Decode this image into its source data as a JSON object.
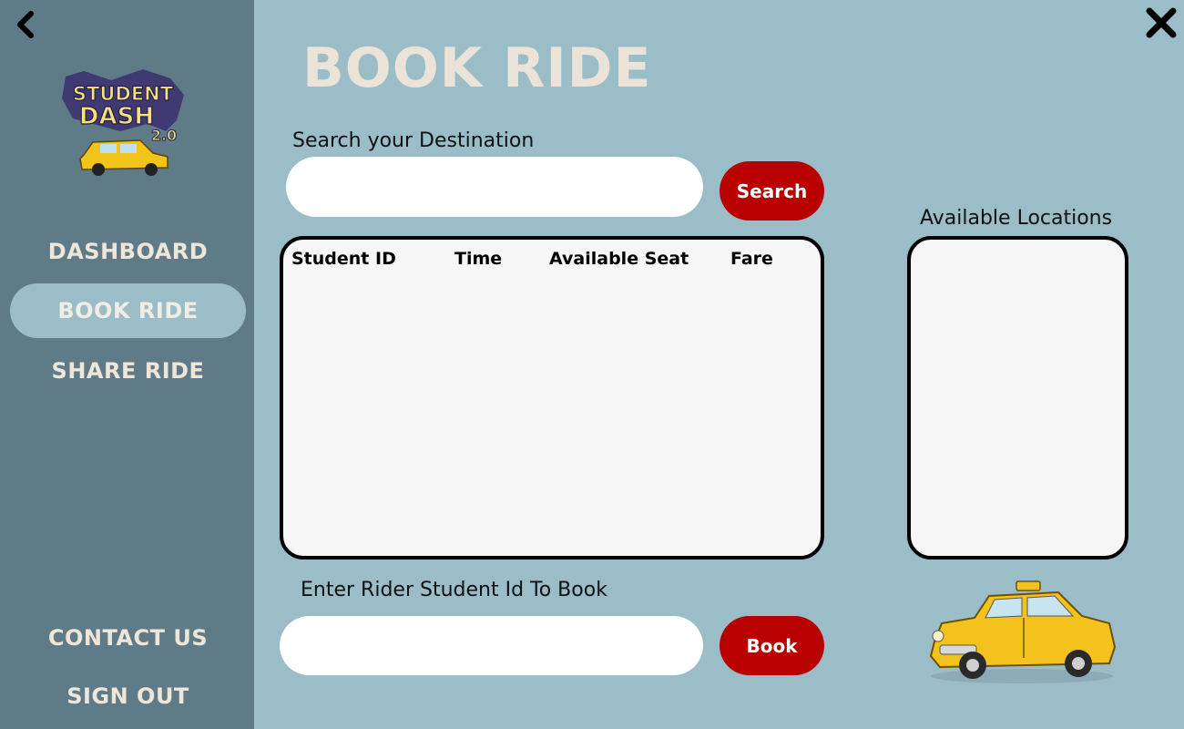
{
  "window": {
    "back_icon": "chevron-left-icon",
    "close_icon": "close-x-icon"
  },
  "sidebar": {
    "logo": {
      "line1": "STUDENT",
      "line2": "DASH",
      "line3": "2.0"
    },
    "items": [
      {
        "label": "DASHBOARD",
        "active": false
      },
      {
        "label": "BOOK RIDE",
        "active": true
      },
      {
        "label": "SHARE RIDE",
        "active": false
      }
    ],
    "bottom_items": [
      {
        "label": "CONTACT US"
      },
      {
        "label": "SIGN OUT"
      }
    ]
  },
  "main": {
    "title": "BOOK RIDE",
    "search": {
      "label": "Search your Destination",
      "value": "",
      "button_label": "Search"
    },
    "table": {
      "columns": [
        "Student ID",
        "Time",
        "Available Seat",
        "Fare"
      ],
      "rows": []
    },
    "locations": {
      "label": "Available Locations",
      "items": []
    },
    "booking": {
      "label": "Enter Rider Student Id To Book",
      "value": "",
      "button_label": "Book"
    }
  },
  "colors": {
    "background": "#9bbdc8",
    "sidebar": "#5f7b88",
    "accent": "#b80000",
    "title": "#ebe3d8"
  }
}
